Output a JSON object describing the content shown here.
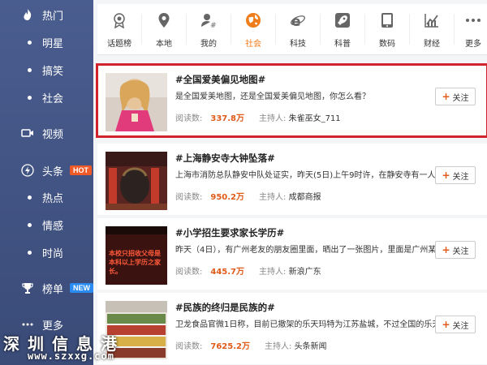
{
  "sidebar": {
    "items": [
      {
        "label": "热门",
        "icon": "fire-icon"
      },
      {
        "label": "明星"
      },
      {
        "label": "搞笑"
      },
      {
        "label": "社会"
      },
      {
        "label": "视频",
        "icon": "video-icon"
      },
      {
        "label": "头条",
        "icon": "lightning-icon",
        "badge": "HOT"
      },
      {
        "label": "热点"
      },
      {
        "label": "情感"
      },
      {
        "label": "时尚"
      },
      {
        "label": "榜单",
        "icon": "trophy-icon",
        "badge": "NEW"
      },
      {
        "label": "更多",
        "icon": "more-icon"
      }
    ],
    "hot_color": "#f05a28",
    "new_color": "#2a8bf2"
  },
  "nav": {
    "items": [
      {
        "label": "话题榜"
      },
      {
        "label": "本地"
      },
      {
        "label": "我的"
      },
      {
        "label": "社会"
      },
      {
        "label": "科技"
      },
      {
        "label": "科普"
      },
      {
        "label": "数码"
      },
      {
        "label": "财经"
      },
      {
        "label": "更多"
      }
    ],
    "active_index": 3,
    "active_color": "#f07d1c"
  },
  "cards": [
    {
      "title": "#全国爱美偏见地图#",
      "desc": "是全国爱美地图，还是全国爱美偏见地图，你怎么看？",
      "reads_label": "阅读数:",
      "reads": "337.8万",
      "host_label": "主持人:",
      "host": "朱雀巫女_711",
      "follow": "关注"
    },
    {
      "title": "#上海静安寺大钟坠落#",
      "desc": "上海市消防总队静安中队处证实，昨天(5日)上午9时许，在静安寺有一人...",
      "reads_label": "阅读数:",
      "reads": "950.2万",
      "host_label": "主持人:",
      "host": "成都商报",
      "follow": "关注"
    },
    {
      "title": "#小学招生要求家长学历#",
      "desc": "昨天（4日），有广州老友的朋友圈里面，晒出了一张图片，里面是广州某...",
      "reads_label": "阅读数:",
      "reads": "445.7万",
      "host_label": "主持人:",
      "host": "新浪广东",
      "follow": "关注",
      "thumb_text": "本校只招收父母是本科以上学历之家长。"
    },
    {
      "title": "#民族的终归是民族的#",
      "desc": "卫龙食品官微1日称，目前已撤架的乐天玛特为江苏盐城，不过全国的乐天...",
      "reads_label": "阅读数:",
      "reads": "7625.2万",
      "host_label": "主持人:",
      "host": "头条新闻",
      "follow": "关注"
    }
  ],
  "watermark": {
    "line1": "深圳信息港",
    "line2": "www.szxxg.com"
  }
}
